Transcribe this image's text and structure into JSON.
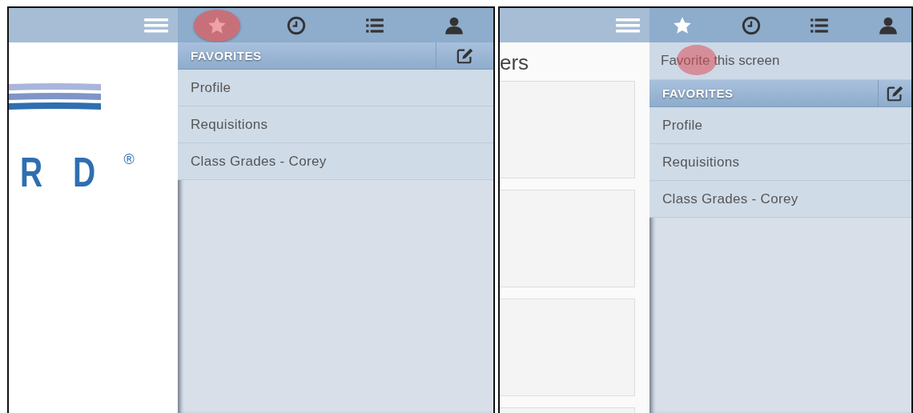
{
  "panels": [
    {
      "app": {
        "kind": "logo",
        "logo_text": "R D",
        "logo_mark": "®"
      },
      "drawer": {
        "tabs": [
          {
            "kind": "star",
            "selected": true,
            "pressed": true
          },
          {
            "kind": "clock",
            "selected": false,
            "pressed": false
          },
          {
            "kind": "list",
            "selected": false,
            "pressed": false
          },
          {
            "kind": "user",
            "selected": false,
            "pressed": false
          }
        ],
        "section": "FAVORITES",
        "items": [
          "Profile",
          "Requisitions",
          "Class Grades - Corey"
        ]
      }
    },
    {
      "app": {
        "kind": "list",
        "title": "ers"
      },
      "drawer": {
        "tabs": [
          {
            "kind": "star",
            "selected": true,
            "pressed": false
          },
          {
            "kind": "clock",
            "selected": false,
            "pressed": false
          },
          {
            "kind": "list",
            "selected": false,
            "pressed": false
          },
          {
            "kind": "user",
            "selected": false,
            "pressed": false
          }
        ],
        "action": {
          "label": "Favorite this screen",
          "pressed": true
        },
        "section": "FAVORITES",
        "items": [
          "Profile",
          "Requisitions",
          "Class Grades - Corey"
        ]
      }
    }
  ]
}
